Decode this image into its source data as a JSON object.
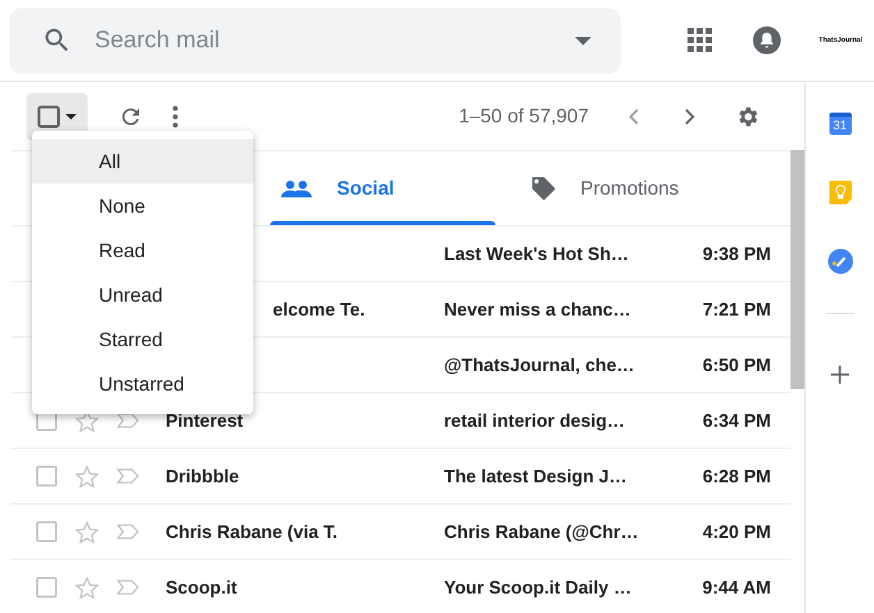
{
  "search": {
    "placeholder": "Search mail"
  },
  "account_logo": {
    "text": "ThatsJournal"
  },
  "toolbar": {
    "range": "1–50 of 57,907"
  },
  "select_menu": {
    "items": [
      {
        "label": "All",
        "highlighted": true
      },
      {
        "label": "None",
        "highlighted": false
      },
      {
        "label": "Read",
        "highlighted": false
      },
      {
        "label": "Unread",
        "highlighted": false
      },
      {
        "label": "Starred",
        "highlighted": false
      },
      {
        "label": "Unstarred",
        "highlighted": false
      }
    ]
  },
  "tabs": [
    {
      "label": "Social",
      "kind": "social",
      "selected": true
    },
    {
      "label": "Promotions",
      "kind": "promotions",
      "selected": false
    }
  ],
  "rows": [
    {
      "subject": "Last Week's Hot Sh…",
      "time": "9:38 PM"
    },
    {
      "sender": "elcome Te.",
      "sender_cut_off": true,
      "subject": "Never miss a chanc…",
      "time": "7:21 PM"
    },
    {
      "subject": "@ThatsJournal, che…",
      "time": "6:50 PM"
    },
    {
      "checked": false,
      "sender": "Pinterest",
      "subject": "retail interior desig…",
      "time": "6:34 PM"
    },
    {
      "checked": false,
      "sender": "Dribbble",
      "subject": "The latest Design J…",
      "time": "6:28 PM"
    },
    {
      "checked": false,
      "sender": "Chris Rabane (via T.",
      "subject": "Chris Rabane (@Chr…",
      "time": "4:20 PM"
    },
    {
      "checked": false,
      "sender": "Scoop.it",
      "subject": "Your Scoop.it Daily …",
      "time": "9:44 AM"
    }
  ],
  "side_panel": {
    "calendar_day": "31"
  }
}
